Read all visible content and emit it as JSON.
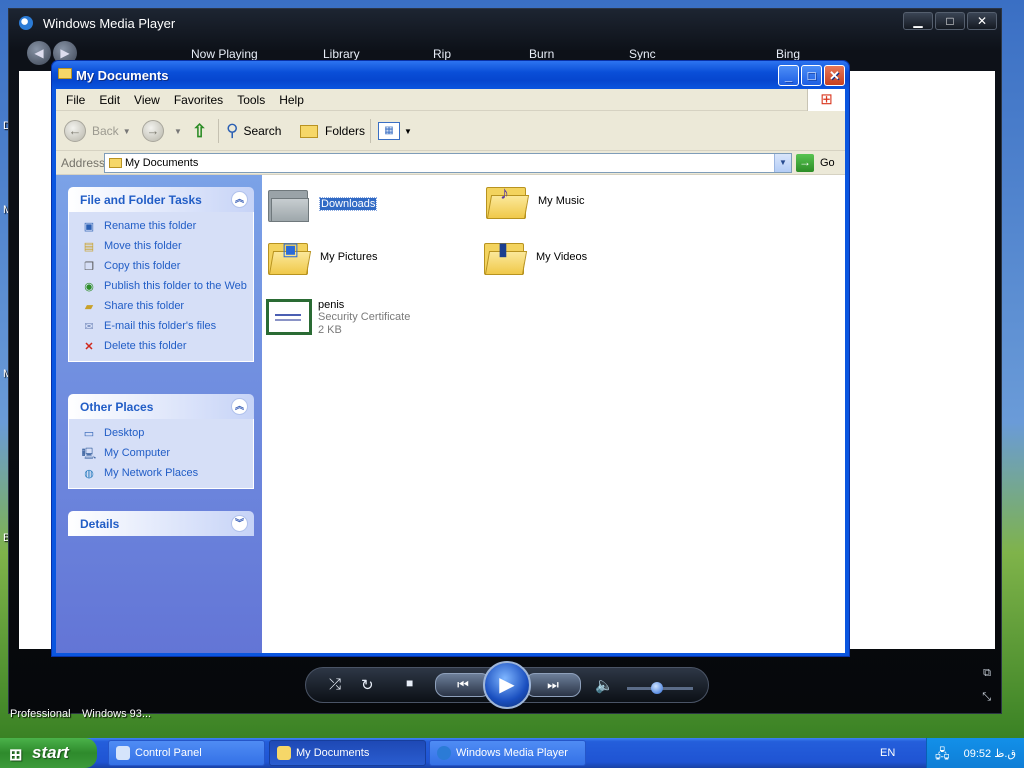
{
  "desktop": {
    "letters": [
      "D",
      "M",
      "M",
      "B"
    ],
    "bottom_labels": [
      "Professional",
      "Windows 93..."
    ]
  },
  "wmp": {
    "title": "Windows Media Player",
    "controls": [
      "▁",
      "□",
      "✕"
    ],
    "back_icon": "◀",
    "forward_icon": "▶",
    "tabs": [
      "Now Playing",
      "Library",
      "Rip",
      "Burn",
      "Sync",
      "Bing"
    ],
    "volume_level": 0.45
  },
  "explorer": {
    "title": "My Documents",
    "title_buttons": [
      "_",
      "□",
      "✕"
    ],
    "menu": [
      "File",
      "Edit",
      "View",
      "Favorites",
      "Tools",
      "Help"
    ],
    "toolbar": {
      "back": "Back",
      "search": "Search",
      "folders": "Folders"
    },
    "address": {
      "label": "Address",
      "value": "My Documents",
      "go": "Go"
    },
    "tasks": {
      "title": "File and Folder Tasks",
      "items": [
        "Rename this folder",
        "Move this folder",
        "Copy this folder",
        "Publish this folder to the Web",
        "Share this folder",
        "E-mail this folder's files",
        "Delete this folder"
      ]
    },
    "other_places": {
      "title": "Other Places",
      "items": [
        "Desktop",
        "My Computer",
        "My Network Places"
      ]
    },
    "details": {
      "title": "Details"
    },
    "files": [
      {
        "name": "Downloads"
      },
      {
        "name": "My Music"
      },
      {
        "name": "My Pictures"
      },
      {
        "name": "My Videos"
      },
      {
        "name": "penis",
        "type": "Security Certificate",
        "size": "2 KB"
      }
    ]
  },
  "taskbar": {
    "start": "start",
    "tasks": [
      "Control Panel",
      "My Documents",
      "Windows Media Player"
    ],
    "language": "EN",
    "clock": "09:52 ق.ظ"
  }
}
